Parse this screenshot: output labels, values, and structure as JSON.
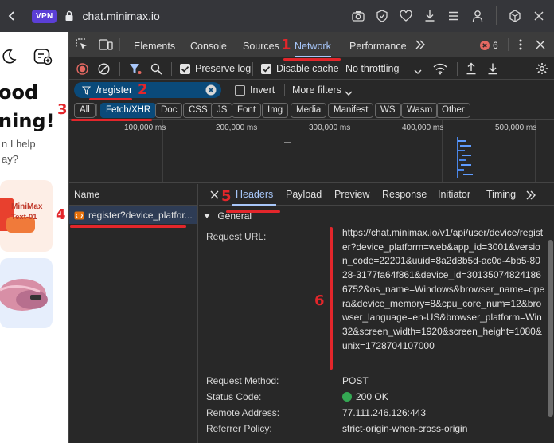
{
  "browser": {
    "vpn_label": "VPN",
    "url": "chat.minimax.io"
  },
  "page": {
    "heading_line1": "ood",
    "heading_line2": "ning!",
    "sub_line1": "n I help",
    "sub_line2": "ay?",
    "card_title": "MiniMax",
    "card_subtitle": "Text-01"
  },
  "devtools": {
    "tabs": [
      "Elements",
      "Console",
      "Sources",
      "Network",
      "Performance"
    ],
    "active_tab": "Network",
    "error_count": "6",
    "toolbar": {
      "preserve_log": "Preserve log",
      "disable_cache": "Disable cache",
      "throttling": "No throttling"
    },
    "filter": {
      "value": "/register",
      "invert": "Invert",
      "more_filters": "More filters"
    },
    "types": [
      "All",
      "Fetch/XHR",
      "Doc",
      "CSS",
      "JS",
      "Font",
      "Img",
      "Media",
      "Manifest",
      "WS",
      "Wasm",
      "Other"
    ],
    "active_type": "Fetch/XHR",
    "timeline_ticks": [
      "100,000 ms",
      "200,000 ms",
      "300,000 ms",
      "400,000 ms",
      "500,000 ms"
    ],
    "name_column": "Name",
    "request_name": "register?device_platfor...",
    "detail_tabs": [
      "Headers",
      "Payload",
      "Preview",
      "Response",
      "Initiator",
      "Timing"
    ],
    "active_detail_tab": "Headers",
    "general_label": "General",
    "general": {
      "request_url_label": "Request URL:",
      "request_url": "https://chat.minimax.io/v1/api/user/device/register?device_platform=web&app_id=3001&version_code=22201&uuid=8a2d8b5d-ac0d-4bb5-8028-3177fa64f861&device_id=301350748241866752&os_name=Windows&browser_name=opera&device_memory=8&cpu_core_num=12&browser_language=en-US&browser_platform=Win32&screen_width=1920&screen_height=1080&unix=1728704107000",
      "method_label": "Request Method:",
      "method": "POST",
      "status_label": "Status Code:",
      "status": "200 OK",
      "remote_label": "Remote Address:",
      "remote": "77.111.246.126:443",
      "referrer_label": "Referrer Policy:",
      "referrer": "strict-origin-when-cross-origin"
    },
    "colors": {
      "accent": "#a8c7fa",
      "record": "#e46962",
      "status_ok": "#34a853",
      "annotation": "#e3262b"
    }
  },
  "annotations": [
    "1",
    "2",
    "3",
    "4",
    "5",
    "6"
  ]
}
